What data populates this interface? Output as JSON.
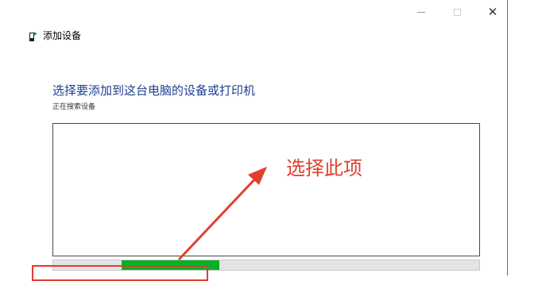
{
  "window": {
    "title": "添加设备",
    "minimize_icon": "minimize-icon",
    "maximize_icon": "maximize-icon",
    "close_icon": "close-icon"
  },
  "main": {
    "heading": "选择要添加到这台电脑的设备或打印机",
    "status": "正在搜索设备"
  },
  "progress": {
    "fill_start": 0.16,
    "fill_end": 0.39,
    "fill_color": "#06b025"
  },
  "annotation": {
    "text": "选择此项",
    "color": "#e0402f"
  },
  "colors": {
    "accent_border": "#2b78c5",
    "heading_color": "#1f3f8f"
  }
}
